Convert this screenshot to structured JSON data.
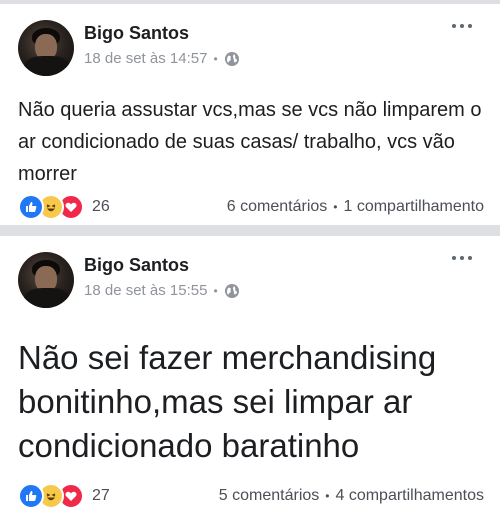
{
  "posts": [
    {
      "author": "Bigo Santos",
      "timestamp": "18 de set às 14:57",
      "separator": "•",
      "text": "Não queria assustar vcs,mas se vcs não limparem o ar condicionado de suas casas/ trabalho, vcs vão morrer",
      "reaction_count": "26",
      "comments": "6 comentários",
      "stats_separator": "•",
      "shares": "1 compartilhamento",
      "reactions": [
        "like-icon",
        "haha-icon",
        "love-icon"
      ]
    },
    {
      "author": "Bigo Santos",
      "timestamp": "18 de set às 15:55",
      "separator": "•",
      "text": "Não sei fazer merchandising bonitinho,mas sei limpar ar condicionado baratinho",
      "reaction_count": "27",
      "comments": "5 comentários",
      "stats_separator": "•",
      "shares": "4 compartilhamentos",
      "reactions": [
        "like-icon",
        "haha-icon",
        "love-icon"
      ]
    }
  ],
  "colors": {
    "like": "#2078f4",
    "haha": "#f7c94a",
    "love": "#f0284a",
    "meta_text": "#90949c",
    "page_bg": "#dddfe2"
  }
}
